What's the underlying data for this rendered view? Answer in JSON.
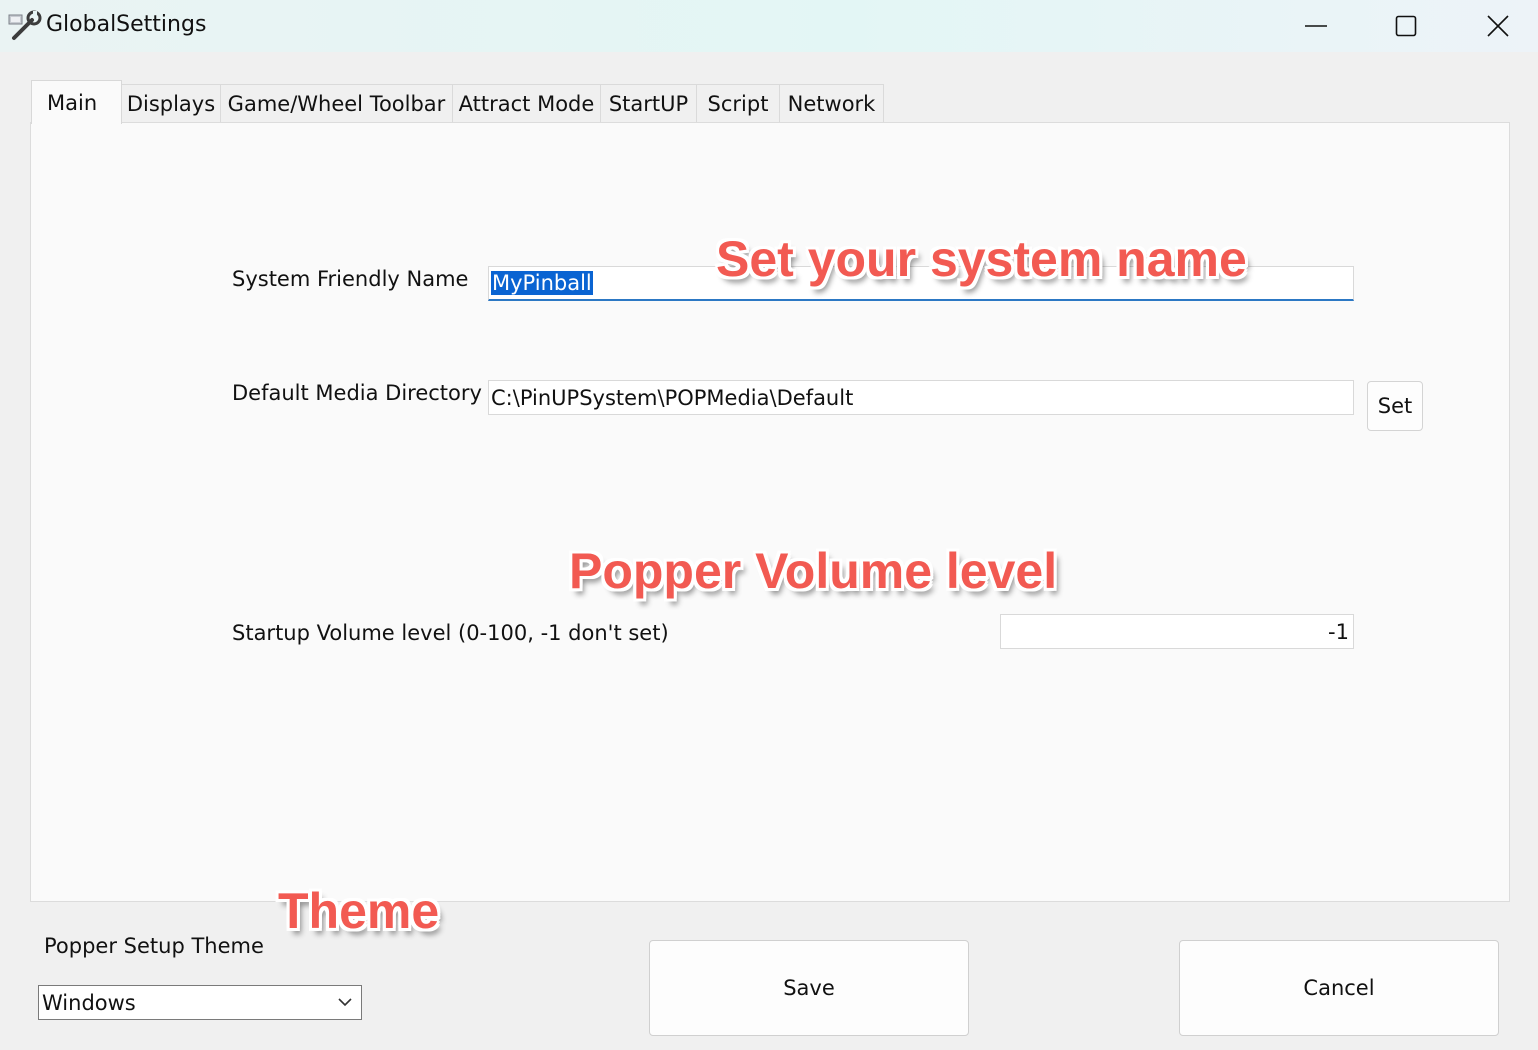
{
  "window": {
    "title": "GlobalSettings",
    "app_icon": "wrench-icon",
    "controls": {
      "minimize": "minimize-icon",
      "maximize": "maximize-icon",
      "close": "close-icon"
    }
  },
  "tabs": [
    {
      "label": "Main",
      "active": true
    },
    {
      "label": "Displays"
    },
    {
      "label": "Game/Wheel Toolbar"
    },
    {
      "label": "Attract Mode"
    },
    {
      "label": "StartUP"
    },
    {
      "label": "Script"
    },
    {
      "label": "Network"
    }
  ],
  "main": {
    "system_name": {
      "label": "System Friendly Name",
      "value": "MyPinball"
    },
    "media_dir": {
      "label": "Default Media Directory",
      "value": "C:\\PinUPSystem\\POPMedia\\Default",
      "button": "Set"
    },
    "volume": {
      "label": "Startup Volume level (0-100, -1 don't set)",
      "value": "-1"
    }
  },
  "annotations": {
    "system_name": "Set your system name",
    "volume": "Popper Volume level",
    "theme": "Theme"
  },
  "footer": {
    "theme_label": "Popper Setup Theme",
    "theme_value": "Windows",
    "save": "Save",
    "cancel": "Cancel"
  },
  "colors": {
    "selection": "#0a64d2",
    "focus_underline": "#2c78c4",
    "callout": "#f25a52"
  }
}
